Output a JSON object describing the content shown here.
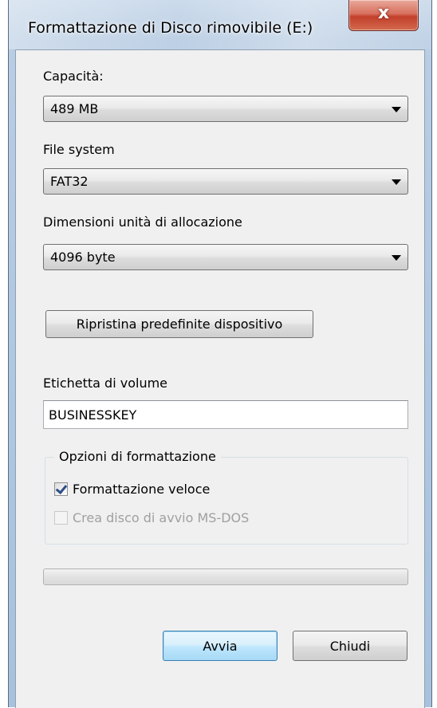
{
  "window": {
    "title": "Formattazione di Disco rimovibile (E:)",
    "close_glyph": "x"
  },
  "capacity": {
    "label": "Capacità:",
    "value": "489 MB"
  },
  "file_system": {
    "label": "File system",
    "value": "FAT32"
  },
  "allocation_unit": {
    "label": "Dimensioni unità di allocazione",
    "value": "4096 byte"
  },
  "restore_defaults_label": "Ripristina predefinite dispositivo",
  "volume_label": {
    "label": "Etichetta di volume",
    "value": "BUSINESSKEY"
  },
  "format_options": {
    "legend": "Opzioni di formattazione",
    "quick_format": {
      "label": "Formattazione veloce",
      "checked": true,
      "enabled": true
    },
    "ms_dos_boot": {
      "label": "Crea disco di avvio MS-DOS",
      "checked": false,
      "enabled": false
    }
  },
  "progress": {
    "percent": 0
  },
  "buttons": {
    "start": "Avvia",
    "close": "Chiudi"
  }
}
